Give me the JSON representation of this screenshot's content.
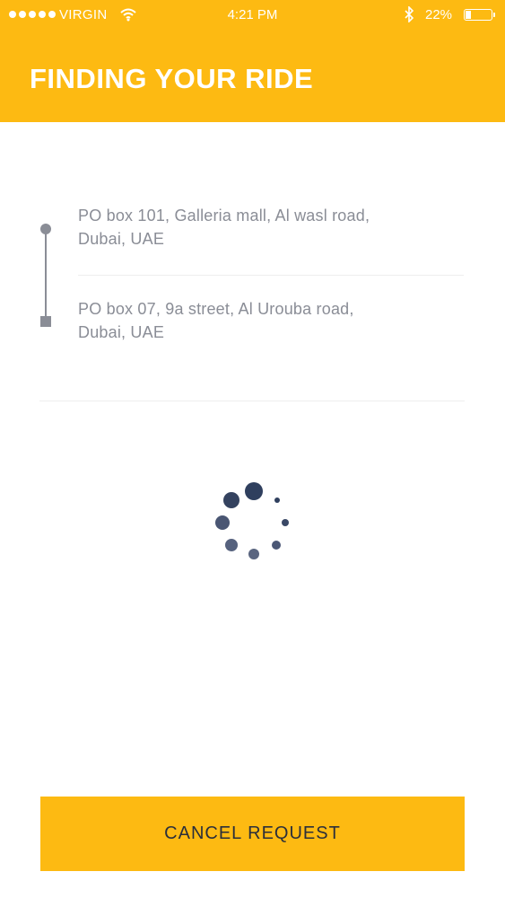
{
  "status_bar": {
    "carrier": "VIRGIN",
    "time": "4:21 PM",
    "battery": "22%",
    "battery_level": 0.22,
    "icons": [
      "signal-dots-icon",
      "wifi-icon",
      "bluetooth-icon",
      "battery-icon"
    ]
  },
  "header": {
    "title": "FINDING YOUR RIDE"
  },
  "trip": {
    "pickup": {
      "line1": "PO box 101, Galleria mall, Al wasl road,",
      "line2": "Dubai, UAE"
    },
    "dropoff": {
      "line1": "PO box 07, 9a street, Al Urouba road,",
      "line2": "Dubai, UAE"
    }
  },
  "actions": {
    "cancel_label": "CANCEL REQUEST"
  },
  "colors": {
    "accent": "#FDBA12",
    "text_muted": "#8a8d96",
    "spinner": "#2f3f5e"
  }
}
